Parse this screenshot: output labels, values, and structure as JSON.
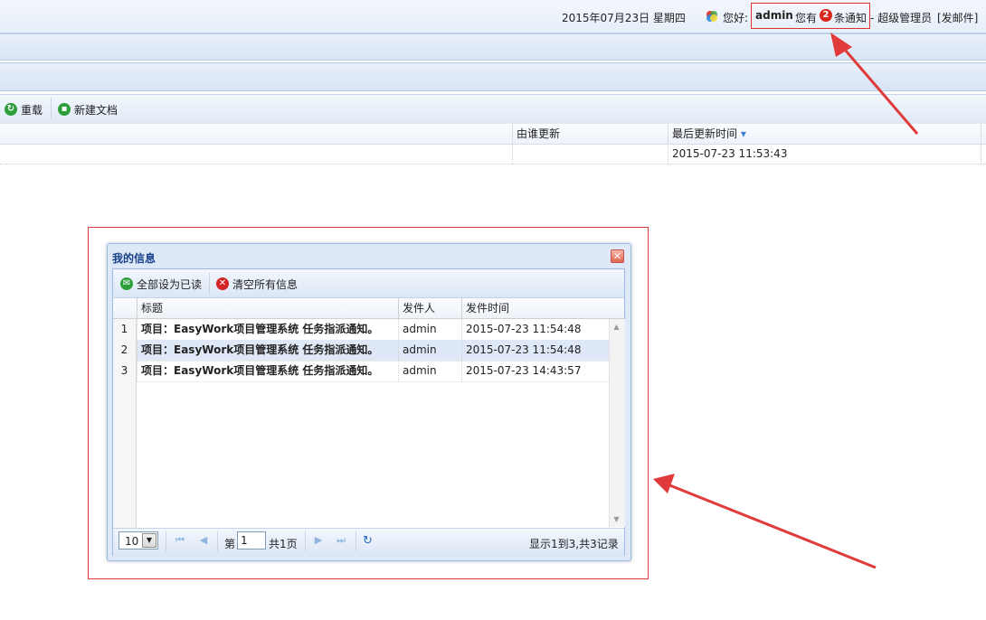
{
  "header": {
    "date": "2015年07月23日 星期四",
    "greeting": "您好:",
    "username": "admin",
    "have": "您有",
    "notice_count": "2",
    "notice_suffix": "条通知",
    "role": "- 超级管理员",
    "send_mail": "[发邮件]",
    "logo_colors": [
      "#e53935",
      "#43a047",
      "#1e88e5",
      "#fdd835"
    ]
  },
  "toolbar": {
    "reload_label": "重载",
    "new_doc_label": "新建文档"
  },
  "grid": {
    "columns": [
      "由谁更新",
      "最后更新时间"
    ],
    "sort_indicator": "▾",
    "rows": [
      {
        "updated_by": "",
        "updated_at": "2015-07-23 11:53:43"
      }
    ]
  },
  "dialog": {
    "title": "我的信息",
    "close_icon": "close-icon",
    "actions": {
      "mark_all_read": "全部设为已读",
      "clear_all": "清空所有信息"
    },
    "columns": [
      "标题",
      "发件人",
      "发件时间"
    ],
    "rows": [
      {
        "num": "1",
        "title": "项目：EasyWork项目管理系统 任务指派通知。",
        "sender": "admin",
        "time": "2015-07-23 11:54:48"
      },
      {
        "num": "2",
        "title": "项目：EasyWork项目管理系统 任务指派通知。",
        "sender": "admin",
        "time": "2015-07-23 11:54:48"
      },
      {
        "num": "3",
        "title": "项目：EasyWork项目管理系统 任务指派通知。",
        "sender": "admin",
        "time": "2015-07-23 14:43:57"
      }
    ],
    "pager": {
      "page_size": "10",
      "page_prefix": "第",
      "current_page": "1",
      "page_suffix": "共1页",
      "record_info": "显示1到3,共3记录"
    }
  },
  "colors": {
    "annotation_red": "#e03a3a",
    "accent_blue": "#15428b"
  }
}
